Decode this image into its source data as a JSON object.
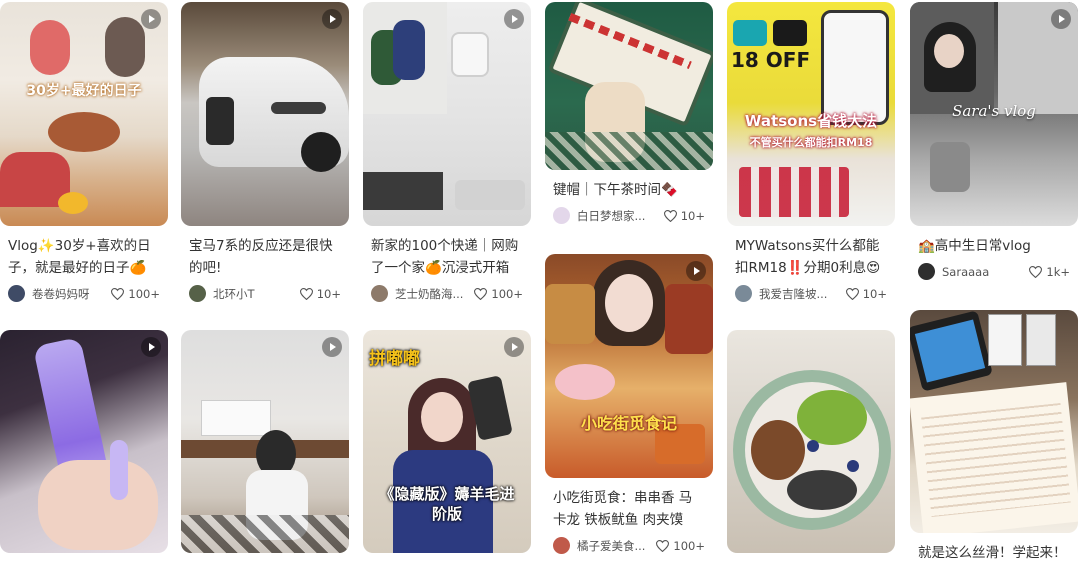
{
  "feed": {
    "cards": [
      {
        "title": "Vlog✨30岁+喜欢的日子，就是最好的日子🍊",
        "overlay": "30岁+最好的日子",
        "author": "卷卷妈妈呀",
        "likes": "100+"
      },
      {
        "title": "宝马7系的反应还是很快的吧!",
        "author": "北环小T",
        "likes": "10+"
      },
      {
        "title": "新家的100个快递｜网购了一个家🍊沉浸式开箱",
        "author": "芝士奶酪海...",
        "likes": "100+"
      },
      {
        "title": "键帽｜下午茶时间🍫",
        "author": "白日梦想家...",
        "likes": "10+"
      },
      {
        "title": "MYWatsons买什么都能扣RM18‼️分期0利息😍",
        "overlay": "Watsons省钱大法",
        "overlay2": "不管买什么都能扣RM18",
        "overlay3": "18 OFF",
        "author": "我爱吉隆坡...",
        "likes": "10+"
      },
      {
        "title": "🏫高中生日常vlog",
        "overlay": "Sara's vlog",
        "author": "Saraaaa",
        "likes": "1k+"
      },
      {
        "title": "",
        "author": "",
        "likes": ""
      },
      {
        "title": "",
        "author": "",
        "likes": ""
      },
      {
        "title": "",
        "overlay": "拼嘟嘟",
        "overlay2": "《隐藏版》薅羊毛进阶版",
        "author": "",
        "likes": ""
      },
      {
        "title": "小吃街觅食：串串香 马卡龙 铁板鱿鱼 肉夹馍",
        "overlay": "小吃街觅食记",
        "author": "橘子爱美食...",
        "likes": "100+"
      },
      {
        "title": "",
        "author": "",
        "likes": ""
      },
      {
        "title": "就是这么丝滑！学起来！",
        "author": "",
        "likes": ""
      }
    ]
  },
  "colors": {
    "accent": "#ff2442",
    "text": "#333333",
    "meta": "#555555"
  }
}
